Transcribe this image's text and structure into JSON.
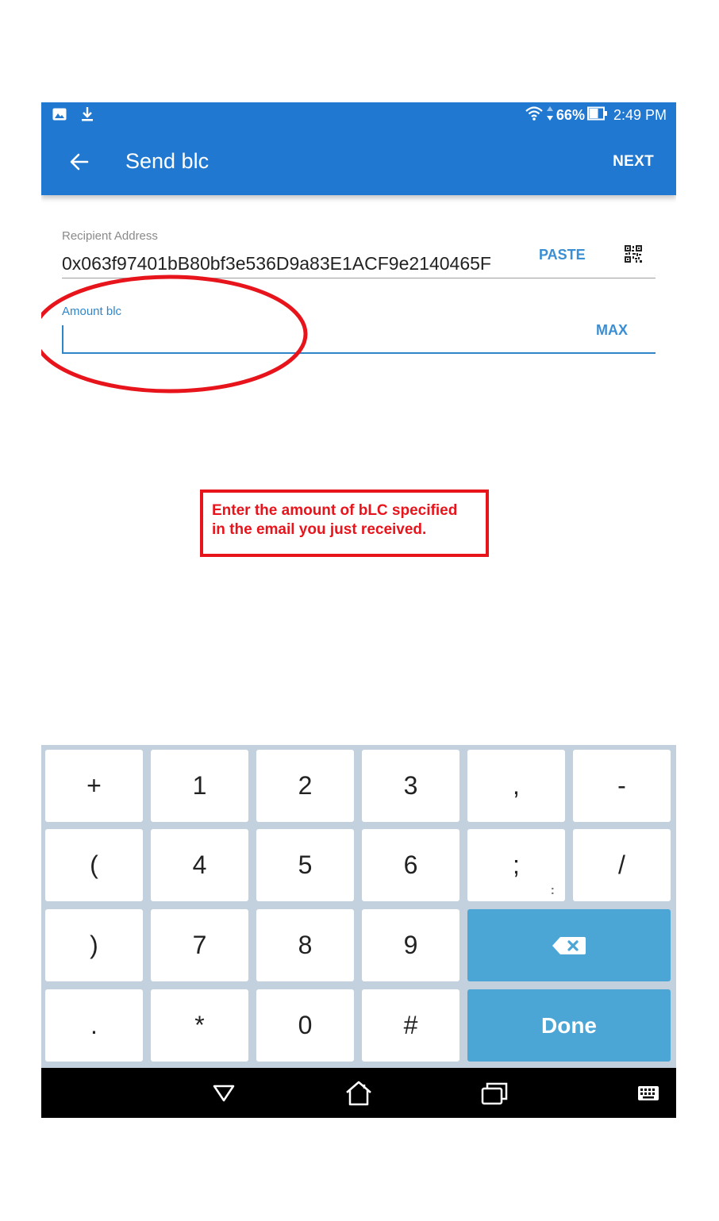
{
  "status_bar": {
    "left_icons": [
      "image-icon",
      "download-icon"
    ],
    "battery": "66%",
    "time": "2:49 PM"
  },
  "app_bar": {
    "title": "Send blc",
    "next_label": "NEXT",
    "color": "#2178d0"
  },
  "form": {
    "recipient": {
      "label": "Recipient Address",
      "value": "0x063f97401bB80bf3e536D9a83E1ACF9e2140465F",
      "paste_label": "PASTE"
    },
    "amount": {
      "label": "Amount blc",
      "value": "",
      "max_label": "MAX"
    }
  },
  "annotation": {
    "line1": "Enter the amount of bLC specified",
    "line2": "in the email you just received.",
    "color": "#e8141c"
  },
  "keypad": {
    "rows": [
      [
        "+",
        "1",
        "2",
        "3",
        ",",
        "-"
      ],
      [
        "(",
        "4",
        "5",
        "6",
        ";",
        "/"
      ],
      [
        ")",
        "7",
        "8",
        "9"
      ],
      [
        ".",
        "*",
        "0",
        "#"
      ]
    ],
    "semicolon_sub": ":",
    "done_label": "Done",
    "accent": "#4ba6d6"
  },
  "nav_bar": {
    "buttons": [
      "back-triangle-icon",
      "home-icon",
      "recents-icon",
      "keyboard-icon"
    ]
  }
}
